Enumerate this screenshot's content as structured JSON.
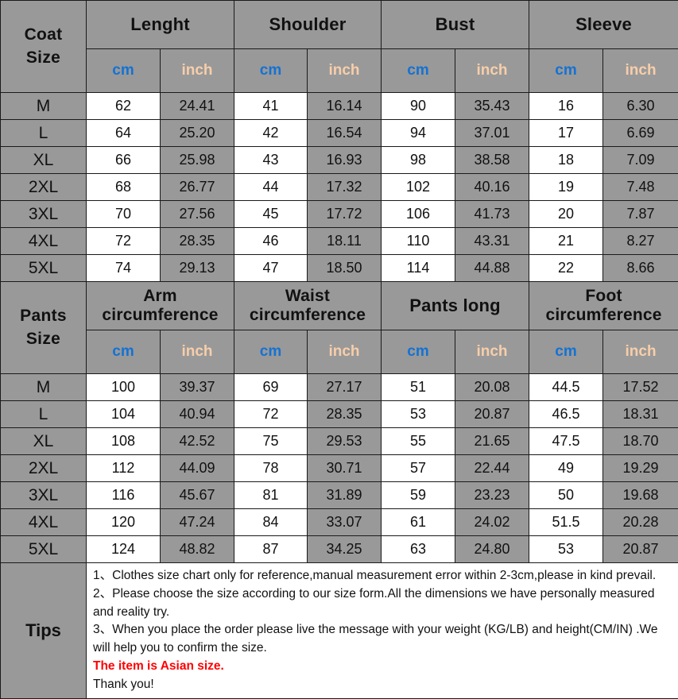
{
  "coat": {
    "size_label": "Coat\nSize",
    "size_label_line1": "Coat",
    "size_label_line2": "Size",
    "groups": [
      {
        "name": "Lenght"
      },
      {
        "name": "Shoulder"
      },
      {
        "name": "Bust"
      },
      {
        "name": "Sleeve"
      }
    ],
    "units": {
      "cm": "cm",
      "inch": "inch"
    },
    "rows": [
      {
        "size": "M",
        "values": [
          "62",
          "24.41",
          "41",
          "16.14",
          "90",
          "35.43",
          "16",
          "6.30"
        ]
      },
      {
        "size": "L",
        "values": [
          "64",
          "25.20",
          "42",
          "16.54",
          "94",
          "37.01",
          "17",
          "6.69"
        ]
      },
      {
        "size": "XL",
        "values": [
          "66",
          "25.98",
          "43",
          "16.93",
          "98",
          "38.58",
          "18",
          "7.09"
        ]
      },
      {
        "size": "2XL",
        "values": [
          "68",
          "26.77",
          "44",
          "17.32",
          "102",
          "40.16",
          "19",
          "7.48"
        ]
      },
      {
        "size": "3XL",
        "values": [
          "70",
          "27.56",
          "45",
          "17.72",
          "106",
          "41.73",
          "20",
          "7.87"
        ]
      },
      {
        "size": "4XL",
        "values": [
          "72",
          "28.35",
          "46",
          "18.11",
          "110",
          "43.31",
          "21",
          "8.27"
        ]
      },
      {
        "size": "5XL",
        "values": [
          "74",
          "29.13",
          "47",
          "18.50",
          "114",
          "44.88",
          "22",
          "8.66"
        ]
      }
    ]
  },
  "pants": {
    "size_label_line1": "Pants",
    "size_label_line2": "Size",
    "groups": [
      {
        "line1": "Arm",
        "line2": "circumference"
      },
      {
        "line1": "Waist",
        "line2": "circumference"
      },
      {
        "line1": "Pants long",
        "line2": ""
      },
      {
        "line1": "Foot",
        "line2": "circumference"
      }
    ],
    "units": {
      "cm": "cm",
      "inch": "inch"
    },
    "rows": [
      {
        "size": "M",
        "values": [
          "100",
          "39.37",
          "69",
          "27.17",
          "51",
          "20.08",
          "44.5",
          "17.52"
        ]
      },
      {
        "size": "L",
        "values": [
          "104",
          "40.94",
          "72",
          "28.35",
          "53",
          "20.87",
          "46.5",
          "18.31"
        ]
      },
      {
        "size": "XL",
        "values": [
          "108",
          "42.52",
          "75",
          "29.53",
          "55",
          "21.65",
          "47.5",
          "18.70"
        ]
      },
      {
        "size": "2XL",
        "values": [
          "112",
          "44.09",
          "78",
          "30.71",
          "57",
          "22.44",
          "49",
          "19.29"
        ]
      },
      {
        "size": "3XL",
        "values": [
          "116",
          "45.67",
          "81",
          "31.89",
          "59",
          "23.23",
          "50",
          "19.68"
        ]
      },
      {
        "size": "4XL",
        "values": [
          "120",
          "47.24",
          "84",
          "33.07",
          "61",
          "24.02",
          "51.5",
          "20.28"
        ]
      },
      {
        "size": "5XL",
        "values": [
          "124",
          "48.82",
          "87",
          "34.25",
          "63",
          "24.80",
          "53",
          "20.87"
        ]
      }
    ]
  },
  "tips": {
    "label": "Tips",
    "line1": "1、Clothes size chart only for reference,manual measurement error within 2-3cm,please in kind prevail.",
    "line2": "2、Please choose the size according to our size form.All the dimensions we have personally measured and reality try.",
    "line3": "3、When you place the order please live the message with your weight (KG/LB) and height(CM/IN) .We will help you to confirm the size.",
    "asian_note": "The item is Asian size.",
    "thanks": "Thank you!"
  },
  "colors": {
    "header_gray": "#999999",
    "cell_white": "#ffffff",
    "cm_blue": "#1572d3",
    "inch_peach": "#f7ceaa",
    "border_dark": "#1a1a1a",
    "asian_red": "#ff0000"
  }
}
